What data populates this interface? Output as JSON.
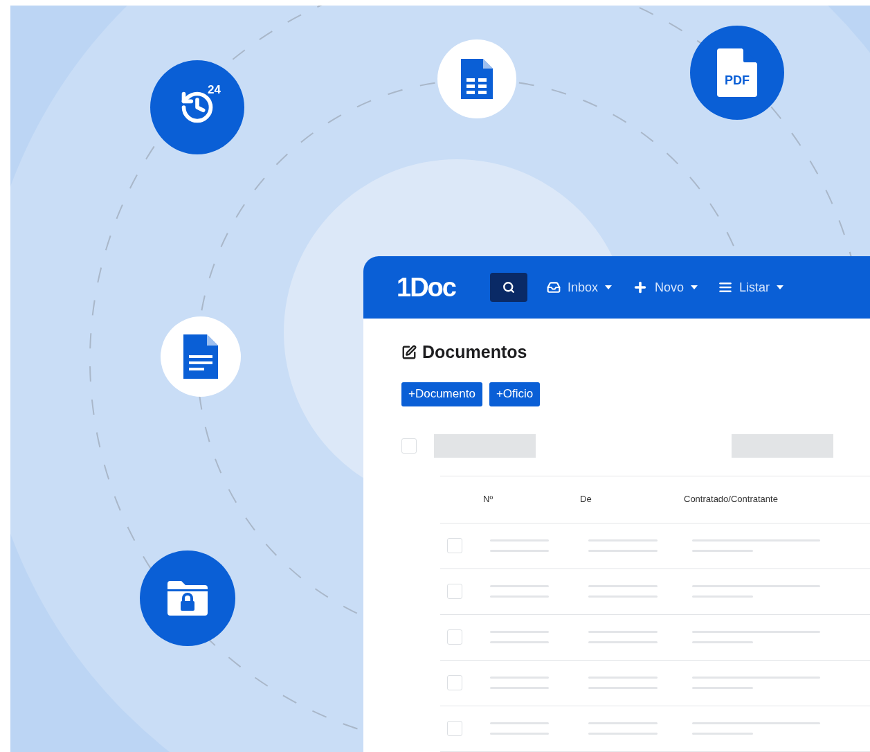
{
  "badges": {
    "clock_label": "24",
    "pdf_label": "PDF"
  },
  "brand": {
    "logo": "1Doc"
  },
  "navbar": {
    "items": [
      {
        "label": "Inbox",
        "kind": "inbox"
      },
      {
        "label": "Novo",
        "kind": "new"
      },
      {
        "label": "Listar",
        "kind": "list"
      }
    ]
  },
  "page": {
    "title": "Documentos",
    "buttons": [
      "+Documento",
      "+Oficio"
    ]
  },
  "toolbar": {
    "select_all": {
      "checked": false
    }
  },
  "table": {
    "columns": [
      "Nº",
      "De",
      "Contratado/Contratante"
    ],
    "rows": [
      {
        "checked": false
      },
      {
        "checked": false
      },
      {
        "checked": false
      },
      {
        "checked": false
      },
      {
        "checked": false
      }
    ]
  }
}
